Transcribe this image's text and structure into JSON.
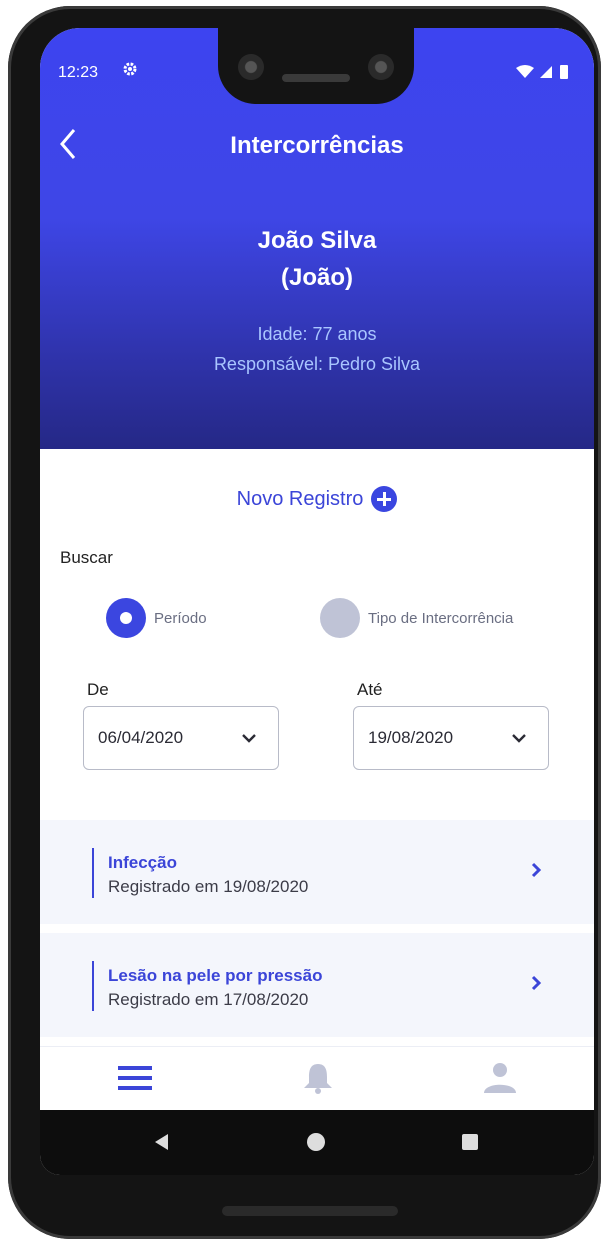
{
  "status_bar": {
    "time": "12:23",
    "settings_icon": "gear-icon"
  },
  "header": {
    "title": "Intercorrências",
    "patient_name": "João Silva",
    "patient_nickname": "(João)",
    "age": "Idade: 77 anos",
    "responsible": "Responsável: Pedro Silva"
  },
  "actions": {
    "new_record": "Novo Registro"
  },
  "search": {
    "label": "Buscar",
    "options": [
      {
        "label": "Período",
        "selected": true
      },
      {
        "label": "Tipo de Intercorrência",
        "selected": false
      }
    ],
    "from": {
      "label": "De",
      "value": "06/04/2020"
    },
    "to": {
      "label": "Até",
      "value": "19/08/2020"
    }
  },
  "records": [
    {
      "title": "Infecção",
      "subtitle": "Registrado em 19/08/2020"
    },
    {
      "title": "Lesão na pele por pressão",
      "subtitle": "Registrado em 17/08/2020"
    }
  ],
  "tabbar": [
    "menu-icon",
    "bell-icon",
    "user-icon"
  ],
  "colors": {
    "primary": "#3b45d8",
    "header_top": "#3d44f0",
    "header_bottom": "#252886"
  }
}
